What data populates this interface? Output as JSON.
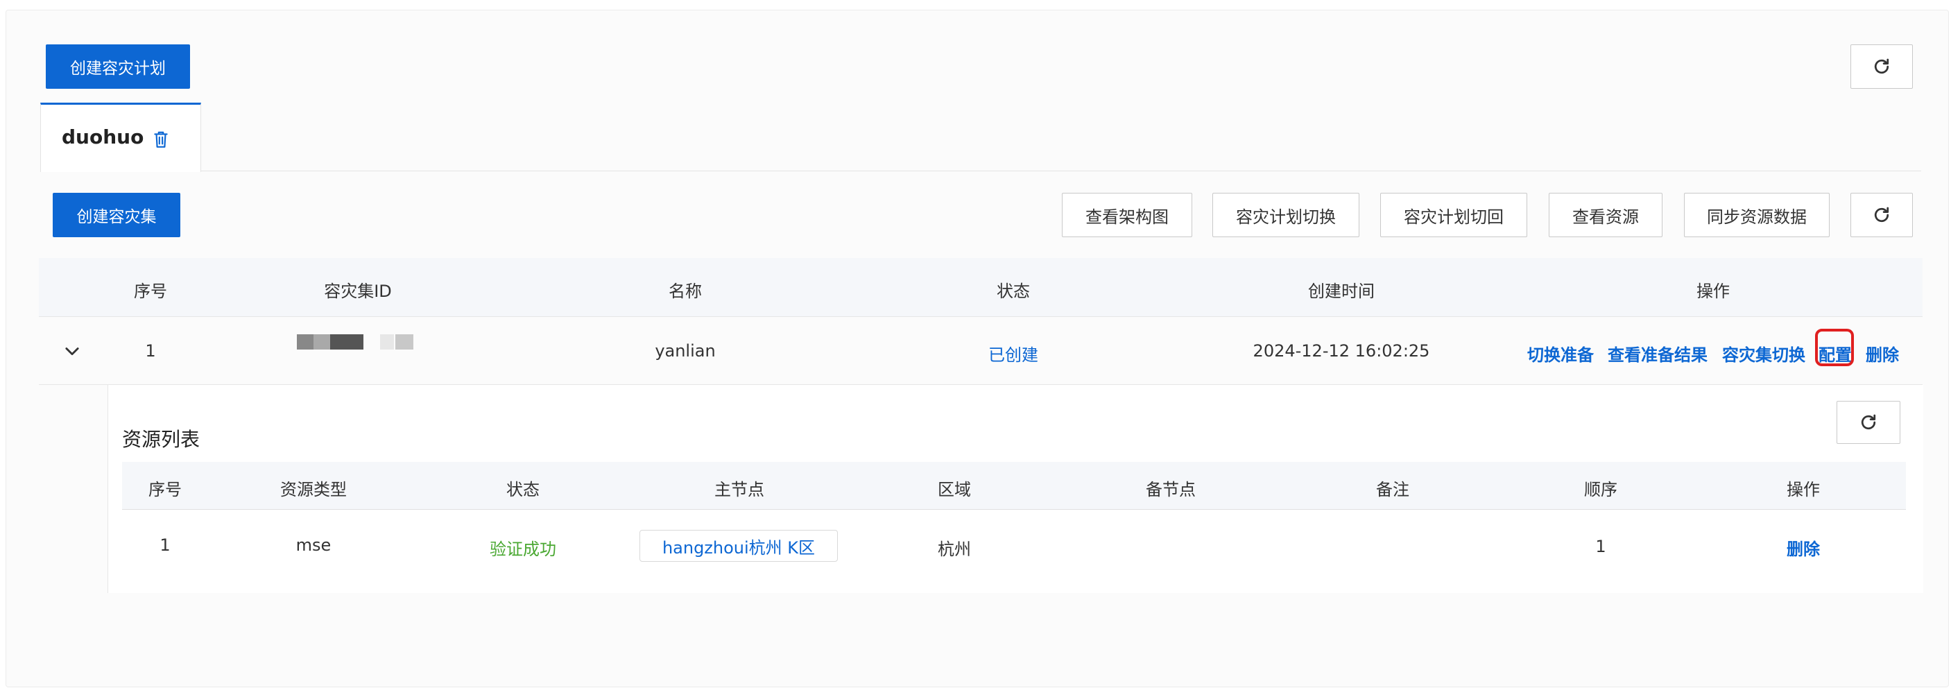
{
  "toolbar": {
    "create_plan_label": "创建容灾计划",
    "create_set_label": "创建容灾集",
    "actions": [
      "查看架构图",
      "容灾计划切换",
      "容灾计划切回",
      "查看资源",
      "同步资源数据"
    ]
  },
  "tab": {
    "label": "duohuo"
  },
  "main_table": {
    "columns": [
      "序号",
      "容灾集ID",
      "名称",
      "状态",
      "创建时间",
      "操作"
    ],
    "rows": [
      {
        "index": "1",
        "id": "",
        "name": "yanlian",
        "status": "已创建",
        "created": "2024-12-12 16:02:25",
        "ops": [
          "切换准备",
          "查看准备结果",
          "容灾集切换",
          "配置",
          "删除"
        ]
      }
    ]
  },
  "resource_panel": {
    "title": "资源列表",
    "columns": [
      "序号",
      "资源类型",
      "状态",
      "主节点",
      "区域",
      "备节点",
      "备注",
      "顺序",
      "操作"
    ],
    "rows": [
      {
        "index": "1",
        "type": "mse",
        "status": "验证成功",
        "primary": "hangzhoui杭州 K区",
        "region": "杭州",
        "backup": "",
        "note": "",
        "order": "1",
        "op": "删除"
      }
    ]
  },
  "colors": {
    "primary": "#0d67d3",
    "success": "#4aa832",
    "highlight": "#e02020"
  },
  "icons": {
    "refresh": "refresh-icon",
    "trash": "trash-icon",
    "expand": "chevron-down-icon"
  }
}
